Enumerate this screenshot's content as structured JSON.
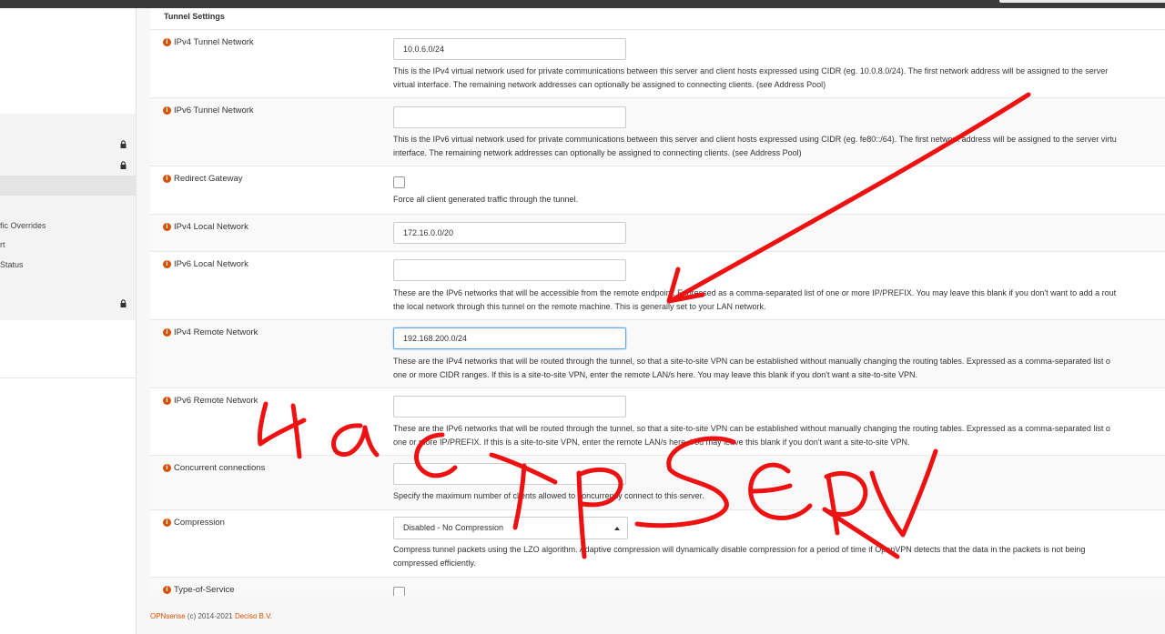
{
  "sidebar": {
    "items": [
      {
        "label": "fic Overrides"
      },
      {
        "label": "rt"
      },
      {
        "label": "Status"
      }
    ]
  },
  "section": {
    "title": "Tunnel Settings"
  },
  "fields": {
    "ipv4_tunnel": {
      "label": "IPv4 Tunnel Network",
      "value": "10.0.6.0/24",
      "hint1": "This is the IPv4 virtual network used for private communications between this server and client hosts expressed using CIDR (eg. 10.0.8.0/24). The first network address will be assigned to the server",
      "hint2": "virtual interface. The remaining network addresses can optionally be assigned to connecting clients. (see Address Pool)"
    },
    "ipv6_tunnel": {
      "label": "IPv6 Tunnel Network",
      "value": "",
      "hint1": "This is the IPv6 virtual network used for private communications between this server and client hosts expressed using CIDR (eg. fe80::/64). The first network address will be assigned to the server virtu",
      "hint2": "interface. The remaining network addresses can optionally be assigned to connecting clients. (see Address Pool)"
    },
    "redirect_gateway": {
      "label": "Redirect Gateway",
      "hint1": "Force all client generated traffic through the tunnel."
    },
    "ipv4_local": {
      "label": "IPv4 Local Network",
      "value": "172.16.0.0/20"
    },
    "ipv6_local": {
      "label": "IPv6 Local Network",
      "value": "",
      "hint1": "These are the IPv6 networks that will be accessible from the remote endpoint. Expressed as a comma-separated list of one or more IP/PREFIX. You may leave this blank if you don't want to add a rout",
      "hint2": "the local network through this tunnel on the remote machine. This is generally set to your LAN network."
    },
    "ipv4_remote": {
      "label": "IPv4 Remote Network",
      "value": "192.168.200.0/24",
      "hint1": "These are the IPv4 networks that will be routed through the tunnel, so that a site-to-site VPN can be established without manually changing the routing tables. Expressed as a comma-separated list o",
      "hint2": "one or more CIDR ranges. If this is a site-to-site VPN, enter the remote LAN/s here. You may leave this blank if you don't want a site-to-site VPN."
    },
    "ipv6_remote": {
      "label": "IPv6 Remote Network",
      "value": "",
      "hint1": "These are the IPv6 networks that will be routed through the tunnel, so that a site-to-site VPN can be established without manually changing the routing tables. Expressed as a comma-separated list o",
      "hint2": "one or more IP/PREFIX. If this is a site-to-site VPN, enter the remote LAN/s here. You may leave this blank if you don't want a site-to-site VPN."
    },
    "concurrent": {
      "label": "Concurrent connections",
      "value": "",
      "hint1": "Specify the maximum number of clients allowed to concurrently connect to this server."
    },
    "compression": {
      "label": "Compression",
      "selected": "Disabled - No Compression",
      "hint1": "Compress tunnel packets using the LZO algorithm. Adaptive compression will dynamically disable compression for a period of time if OpenVPN detects that the data in the packets is not being",
      "hint2": "compressed efficiently."
    },
    "tos": {
      "label": "Type-of-Service"
    }
  },
  "footer": {
    "brand": "OPNsense",
    "copyright": " (c) 2014-2021 ",
    "company": "Deciso B.V."
  },
  "annotation": {
    "color": "#ee1111",
    "handwriting": "Настр SERV"
  },
  "colors": {
    "accent": "#d94f00",
    "topbar": "#3a3a3a"
  }
}
